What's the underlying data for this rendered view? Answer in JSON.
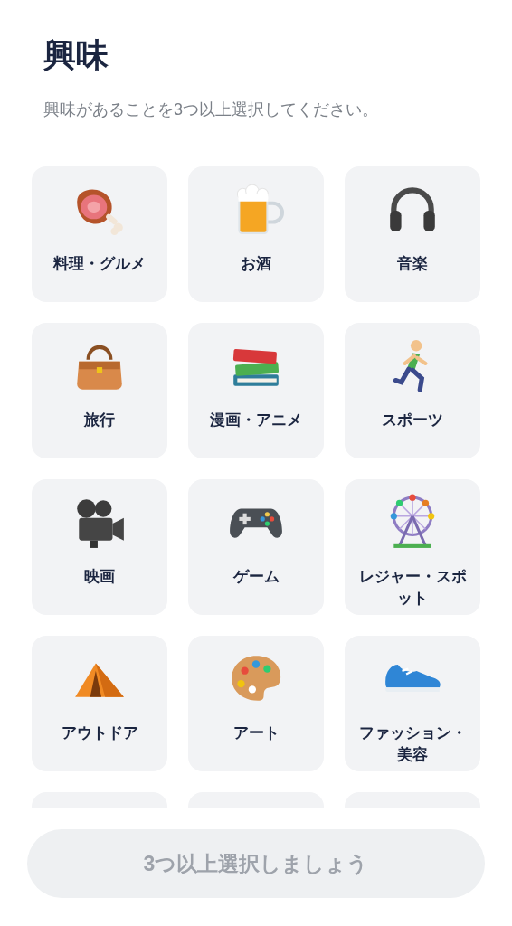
{
  "title": "興味",
  "subtitle": "興味があることを3つ以上選択してください。",
  "interests": [
    {
      "label": "料理・グルメ",
      "selected": false
    },
    {
      "label": "お酒",
      "selected": false
    },
    {
      "label": "音楽",
      "selected": false
    },
    {
      "label": "旅行",
      "selected": false
    },
    {
      "label": "漫画・アニメ",
      "selected": false
    },
    {
      "label": "スポーツ",
      "selected": false
    },
    {
      "label": "映画",
      "selected": false
    },
    {
      "label": "ゲーム",
      "selected": false
    },
    {
      "label": "レジャー・スポット",
      "selected": false
    },
    {
      "label": "アウトドア",
      "selected": false
    },
    {
      "label": "アート",
      "selected": false
    },
    {
      "label": "ファッション・美容",
      "selected": false
    }
  ],
  "partial_row": [
    {
      "selected": false
    },
    {
      "selected": false
    },
    {
      "selected": false
    }
  ],
  "submit_button": {
    "label": "3つ以上選択しましょう",
    "disabled": true
  }
}
